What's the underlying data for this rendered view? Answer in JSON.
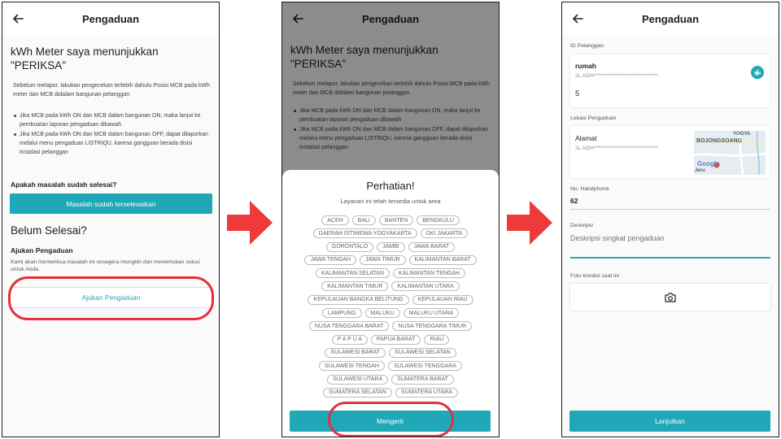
{
  "screen1": {
    "title": "Pengaduan",
    "heading_line1": "kWh Meter saya menunjukkan",
    "heading_line2": "\"PERIKSA\"",
    "intro": "Sebelum melapor, lakukan pengecekan terlebih dahulu Posisi MCB pada kWh meter dan MCB didalam bangunan pelanggan",
    "bullets": [
      "Jika MCB pada kWh ON dan MCB dalam bangunan ON, maka lanjut ke pembuatan laporan pengaduan dibawah",
      "Jika MCB pada kWh ON dan MCB dalam bangunan OFF, dapat dilaporkan melalui menu pengaduan LISTRIQU, karena gangguan berada disisi instalasi pelanggan"
    ],
    "question": "Apakah masalah sudah selesai?",
    "resolved_button": "Masalah sudah terselesaikan",
    "not_done_heading": "Belum Selesai?",
    "complaint_label": "Ajukan Pengaduan",
    "complaint_desc": "Kami akan memeriksa masalah ini sesegera mungkin dan menemukan solusi untuk Anda.",
    "complaint_button": "Ajukan Pengaduan"
  },
  "screen2": {
    "title": "Pengaduan",
    "sheet_title": "Perhatian!",
    "sheet_subtitle": "Layanan ini telah tersedia untuk area",
    "areas": [
      [
        "ACEH",
        "BALI",
        "BANTEN",
        "BENGKULU"
      ],
      [
        "DAERAH ISTIMEWA YOGYAKARTA",
        "DKI JAKARTA"
      ],
      [
        "GORONTALO",
        "JAMBI",
        "JAWA BARAT"
      ],
      [
        "JAWA TENGAH",
        "JAWA TIMUR",
        "KALIMANTAN BARAT"
      ],
      [
        "KALIMANTAN SELATAN",
        "KALIMANTAN TENGAH"
      ],
      [
        "KALIMANTAN TIMUR",
        "KALIMANTAN UTARA"
      ],
      [
        "KEPULAUAN BANGKA BELITUNG",
        "KEPULAUAN RIAU"
      ],
      [
        "LAMPUNG",
        "MALUKU",
        "MALUKU UTARA"
      ],
      [
        "NUSA TENGGARA BARAT",
        "NUSA TENGGARA TIMUR"
      ],
      [
        "P A P U A",
        "PAPUA BARAT",
        "RIAU"
      ],
      [
        "SULAWESI BARAT",
        "SULAWESI SELATAN"
      ],
      [
        "SULAWESI TENGAH",
        "SULAWESI TENGGARA"
      ],
      [
        "SULAWESI UTARA",
        "SUMATERA BARAT"
      ],
      [
        "SUMATERA SELATAN",
        "SUMATERA UTARA"
      ]
    ],
    "confirm_button": "Mengerti"
  },
  "screen3": {
    "title": "Pengaduan",
    "customer_id_label": "ID Pelanggan",
    "customer_name": "rumah",
    "customer_address": "JL ADH*****************************",
    "customer_number": "5",
    "location_label": "Lokasi Pengaduan",
    "location_title": "Alamat",
    "location_address": "JL ADH*****************************",
    "map_labels": [
      "YOGYA",
      "BOJONGSOANG",
      "Google",
      "Jeru"
    ],
    "phone_label": "No. Handphone",
    "phone_value": "62",
    "description_label": "Deskripsi",
    "description_placeholder": "Deskripsi singkat pengaduan",
    "photo_label": "Foto kondisi saat ini",
    "continue_button": "Lanjutkan"
  },
  "colors": {
    "accent": "#20a8b8",
    "highlight": "#e0323a",
    "flow_arrow": "#ee3a3a"
  },
  "icons": {
    "back": "arrow-left-icon",
    "camera": "camera-icon",
    "brand": "pln-logo-icon",
    "flow": "arrow-right-icon"
  }
}
